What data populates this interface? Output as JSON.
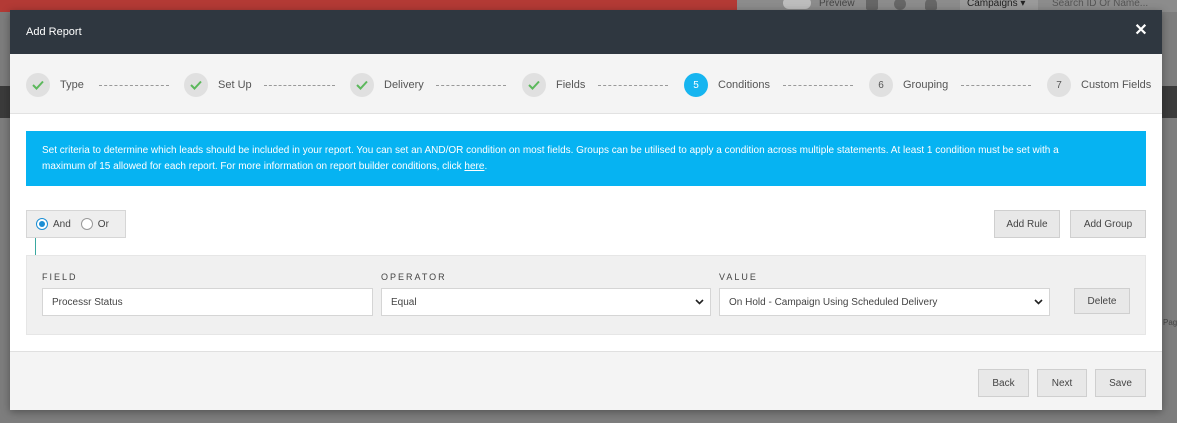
{
  "background": {
    "preview_label": "Preview",
    "campaigns_label": "Campaigns",
    "search_placeholder": "Search ID Or Name...",
    "right_fragment": "Page"
  },
  "modal": {
    "title": "Add Report",
    "close_symbol": "✕"
  },
  "steps": [
    {
      "number": "",
      "label": "Type",
      "status": "done"
    },
    {
      "number": "",
      "label": "Set Up",
      "status": "done"
    },
    {
      "number": "",
      "label": "Delivery",
      "status": "done"
    },
    {
      "number": "",
      "label": "Fields",
      "status": "done"
    },
    {
      "number": "5",
      "label": "Conditions",
      "status": "active"
    },
    {
      "number": "6",
      "label": "Grouping",
      "status": "pending"
    },
    {
      "number": "7",
      "label": "Custom Fields",
      "status": "pending"
    }
  ],
  "info": {
    "text_line1": "Set criteria to determine which leads should be included in your report. You can set an AND/OR condition on most fields. Groups can be utilised to apply a condition across multiple statements. At least 1 condition must be set with a",
    "text_line2": "maximum of 15 allowed for each report. For more information on report builder conditions, click ",
    "link_text": "here",
    "text_end": "."
  },
  "logic": {
    "and_label": "And",
    "or_label": "Or",
    "selected": "and"
  },
  "actions": {
    "add_rule": "Add Rule",
    "add_group": "Add Group"
  },
  "rule": {
    "field_label": "FIELD",
    "field_value": "Processr Status",
    "operator_label": "OPERATOR",
    "operator_value": "Equal",
    "value_label": "VALUE",
    "value_value": "On Hold - Campaign Using Scheduled Delivery",
    "delete_label": "Delete"
  },
  "footer": {
    "back": "Back",
    "next": "Next",
    "save": "Save"
  },
  "colors": {
    "header": "#2f3740",
    "accent": "#06b3f2",
    "check": "#5cb85c",
    "tree_line": "#3aa8a0"
  },
  "icons": {
    "close": "close-icon",
    "check": "check-icon",
    "chevron": "chevron-down-icon"
  }
}
